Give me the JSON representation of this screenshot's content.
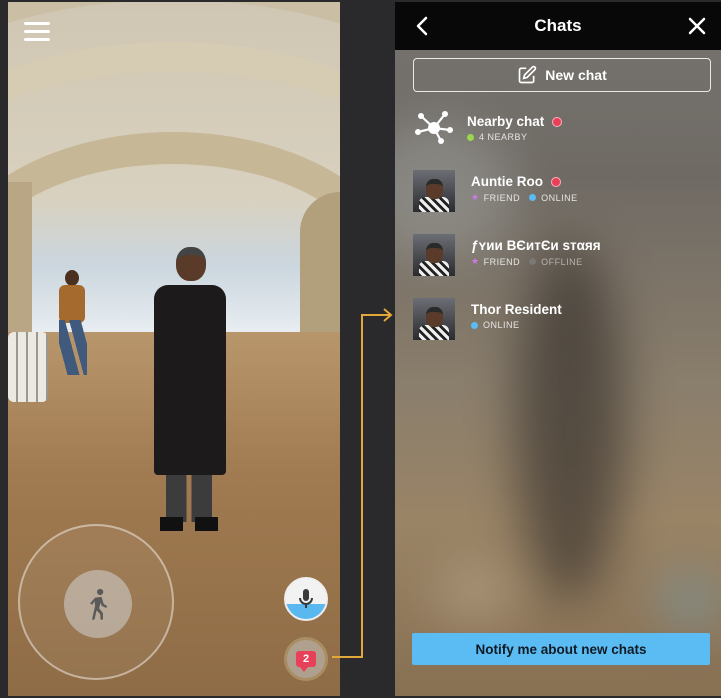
{
  "scene": {
    "chat_badge_count": "2"
  },
  "chats_panel": {
    "title": "Chats",
    "new_chat_label": "New chat",
    "items": [
      {
        "name": "Nearby chat",
        "unread": true,
        "tags": [
          {
            "label": "4 NEARBY",
            "dot_color": "#9bd74a"
          }
        ]
      },
      {
        "name": "Auntie Roo",
        "unread": true,
        "tags": [
          {
            "label": "FRIEND",
            "star": true
          },
          {
            "label": "ONLINE",
            "dot_color": "#5bbcf4"
          }
        ]
      },
      {
        "name": "ƒʏии BЄитЄи ѕтαяя",
        "unread": false,
        "tags": [
          {
            "label": "FRIEND",
            "star": true
          },
          {
            "label": "OFFLINE",
            "dot_color": "#7a7875"
          }
        ]
      },
      {
        "name": "Thor Resident",
        "unread": false,
        "tags": [
          {
            "label": "ONLINE",
            "dot_color": "#5bbcf4"
          }
        ]
      }
    ],
    "notify_label": "Notify me about new chats"
  },
  "colors": {
    "accent_blue": "#5bbcf4",
    "unread_red": "#e9405a",
    "friend_star": "#d177e8",
    "connector_yellow": "#e3a83a"
  }
}
